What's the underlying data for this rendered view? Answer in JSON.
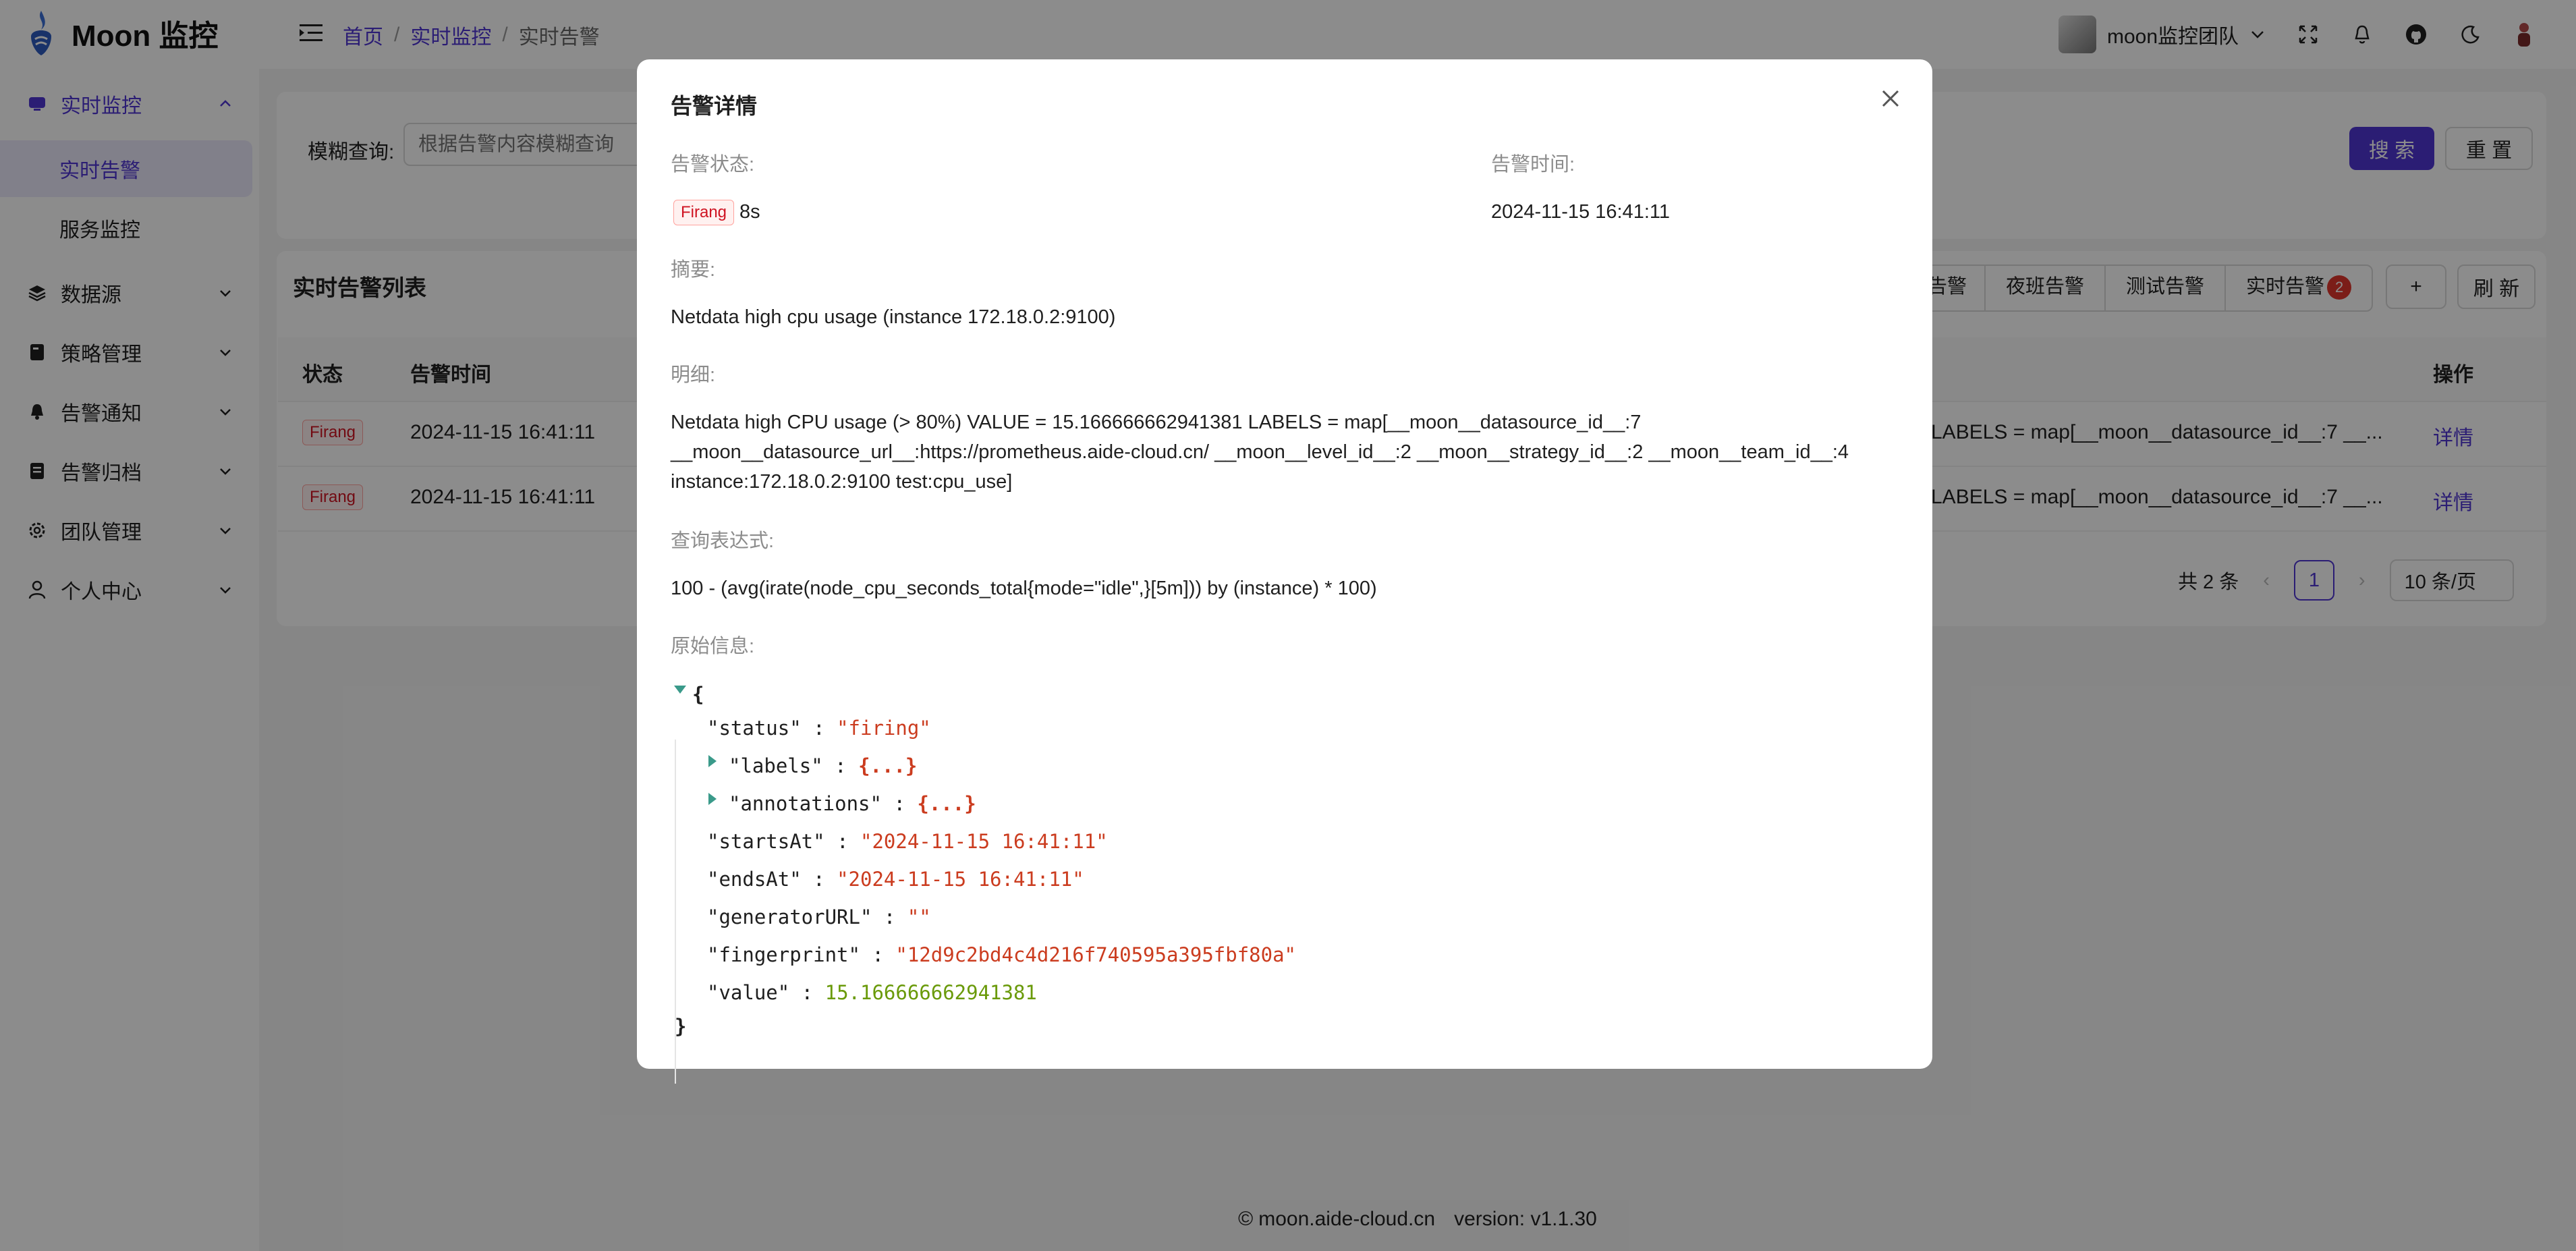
{
  "app": {
    "title": "Moon 监控"
  },
  "sidebar": {
    "items": [
      {
        "label": "实时监控",
        "icon": "monitor-icon",
        "expanded": true,
        "children": [
          {
            "label": "实时告警"
          },
          {
            "label": "服务监控"
          }
        ]
      },
      {
        "label": "数据源",
        "icon": "layers-icon"
      },
      {
        "label": "策略管理",
        "icon": "book-icon"
      },
      {
        "label": "告警通知",
        "icon": "bell-icon"
      },
      {
        "label": "告警归档",
        "icon": "archive-icon"
      },
      {
        "label": "团队管理",
        "icon": "gear-icon"
      },
      {
        "label": "个人中心",
        "icon": "user-icon"
      }
    ]
  },
  "header": {
    "breadcrumb": [
      "首页",
      "实时监控",
      "实时告警"
    ],
    "breadcrumb_sep": "/",
    "team_name": "moon监控团队"
  },
  "search": {
    "label": "模糊查询:",
    "placeholder": "根据告警内容模糊查询",
    "search_button": "搜 索",
    "reset_button": "重 置"
  },
  "list": {
    "title": "实时告警列表",
    "tabs": [
      "班告警",
      "夜班告警",
      "测试告警",
      "实时告警"
    ],
    "tab_badge": "2",
    "add_button": "+",
    "refresh_button": "刷 新",
    "columns": {
      "status": "状态",
      "time": "告警时间",
      "action": "操作"
    },
    "rows": [
      {
        "status": "Firang",
        "time": "2024-11-15 16:41:11",
        "detail_tail": "LABELS = map[__moon__datasource_id__:7 __...",
        "action": "详情"
      },
      {
        "status": "Firang",
        "time": "2024-11-15 16:41:11",
        "detail_tail": "LABELS = map[__moon__datasource_id__:7 __...",
        "action": "详情"
      }
    ],
    "pagination": {
      "total": "共 2 条",
      "page": "1",
      "page_size": "10 条/页"
    }
  },
  "modal": {
    "title": "告警详情",
    "status_label": "告警状态:",
    "status_tag": "Firang",
    "status_duration": "8s",
    "time_label": "告警时间:",
    "time_value": "2024-11-15 16:41:11",
    "summary_label": "摘要:",
    "summary_value": "Netdata high cpu usage (instance 172.18.0.2:9100)",
    "detail_label": "明细:",
    "detail_lines": [
      "Netdata high CPU usage (> 80%) VALUE = 15.166666662941381 LABELS = map[__moon__datasource_id__:7",
      "__moon__datasource_url__:https://prometheus.aide-cloud.cn/ __moon__level_id__:2 __moon__strategy_id__:2 __moon__team_id__:4",
      "instance:172.18.0.2:9100 test:cpu_use]"
    ],
    "expr_label": "查询表达式:",
    "expr_value": "100 - (avg(irate(node_cpu_seconds_total{mode=\"idle\",}[5m])) by (instance) * 100)",
    "raw_label": "原始信息:",
    "raw": {
      "status": "\"firing\"",
      "labels_collapsed": "{...}",
      "annotations_collapsed": "{...}",
      "startsAt": "\"2024-11-15 16:41:11\"",
      "endsAt": "\"2024-11-15 16:41:11\"",
      "generatorURL": "\"\"",
      "fingerprint": "\"12d9c2bd4c4d216f740595a395fbf80a\"",
      "value": "15.166666662941381"
    },
    "raw_keys": {
      "status": "\"status\"",
      "labels": "\"labels\"",
      "annotations": "\"annotations\"",
      "startsAt": "\"startsAt\"",
      "endsAt": "\"endsAt\"",
      "generatorURL": "\"generatorURL\"",
      "fingerprint": "\"fingerprint\"",
      "value": "\"value\""
    }
  },
  "footer": {
    "site": "moon.aide-cloud.cn",
    "version": "version: v1.1.30"
  },
  "colors": {
    "accent": "#4f35d4",
    "firing": "#cf1322",
    "json_string": "#cb3c1f",
    "json_number": "#6a9a0a"
  }
}
